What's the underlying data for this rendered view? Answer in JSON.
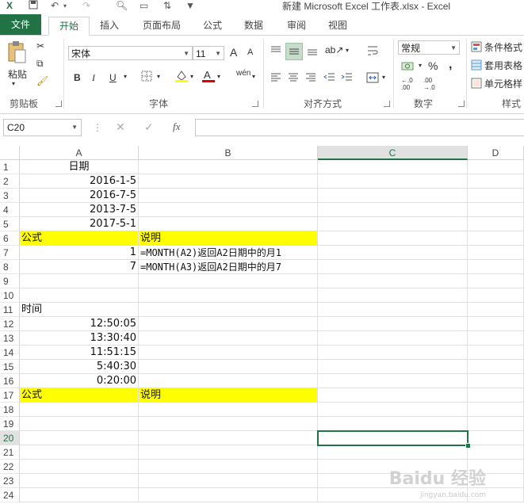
{
  "window": {
    "title": "新建 Microsoft Excel 工作表.xlsx - Excel"
  },
  "tabs": [
    {
      "label": "文件"
    },
    {
      "label": "开始"
    },
    {
      "label": "插入"
    },
    {
      "label": "页面布局"
    },
    {
      "label": "公式"
    },
    {
      "label": "数据"
    },
    {
      "label": "审阅"
    },
    {
      "label": "视图"
    }
  ],
  "ribbon": {
    "clipboard": {
      "paste": "粘贴",
      "group": "剪贴板"
    },
    "font": {
      "name": "宋体",
      "size": "11",
      "group": "字体",
      "bold": "B",
      "italic": "I",
      "underline": "U",
      "grow": "A",
      "shrink": "A",
      "phonetic": "wén"
    },
    "alignment": {
      "group": "对齐方式"
    },
    "number": {
      "format": "常规",
      "group": "数字",
      "percent": "%",
      "comma": ",",
      "inc": "←.0 .00",
      "dec": ".00 →.0"
    },
    "styles": {
      "conditional": "条件格式",
      "table": "套用表格",
      "cell": "单元格样",
      "group": "样式"
    }
  },
  "formula_bar": {
    "name_box": "C20",
    "cancel": "✕",
    "enter": "✓",
    "fx": "fx",
    "content": ""
  },
  "columns": [
    "A",
    "B",
    "C",
    "D"
  ],
  "rows": [
    "1",
    "2",
    "3",
    "4",
    "5",
    "6",
    "7",
    "8",
    "9",
    "10",
    "11",
    "12",
    "13",
    "14",
    "15",
    "16",
    "17",
    "18",
    "19",
    "20",
    "21",
    "22",
    "23",
    "24"
  ],
  "cells": {
    "A1": "日期",
    "A2": "2016-1-5",
    "A3": "2016-7-5",
    "A4": "2013-7-5",
    "A5": "2017-5-1",
    "A6": "公式",
    "B6": "说明",
    "A7": "1",
    "B7": "=MONTH(A2)返回A2日期中的月1",
    "A8": "7",
    "B8": "=MONTH(A3)返回A2日期中的月7",
    "A11": "时间",
    "A12": "12:50:05",
    "A13": "13:30:40",
    "A14": "11:51:15",
    "A15": "5:40:30",
    "A16": "0:20:00",
    "A17": "公式",
    "B17": "说明"
  },
  "selected_cell": "C20",
  "colors": {
    "accent": "#217346",
    "highlight": "#ffff00"
  },
  "watermark": {
    "main": "Baidu 经验",
    "sub": "jingyan.baidu.com"
  }
}
